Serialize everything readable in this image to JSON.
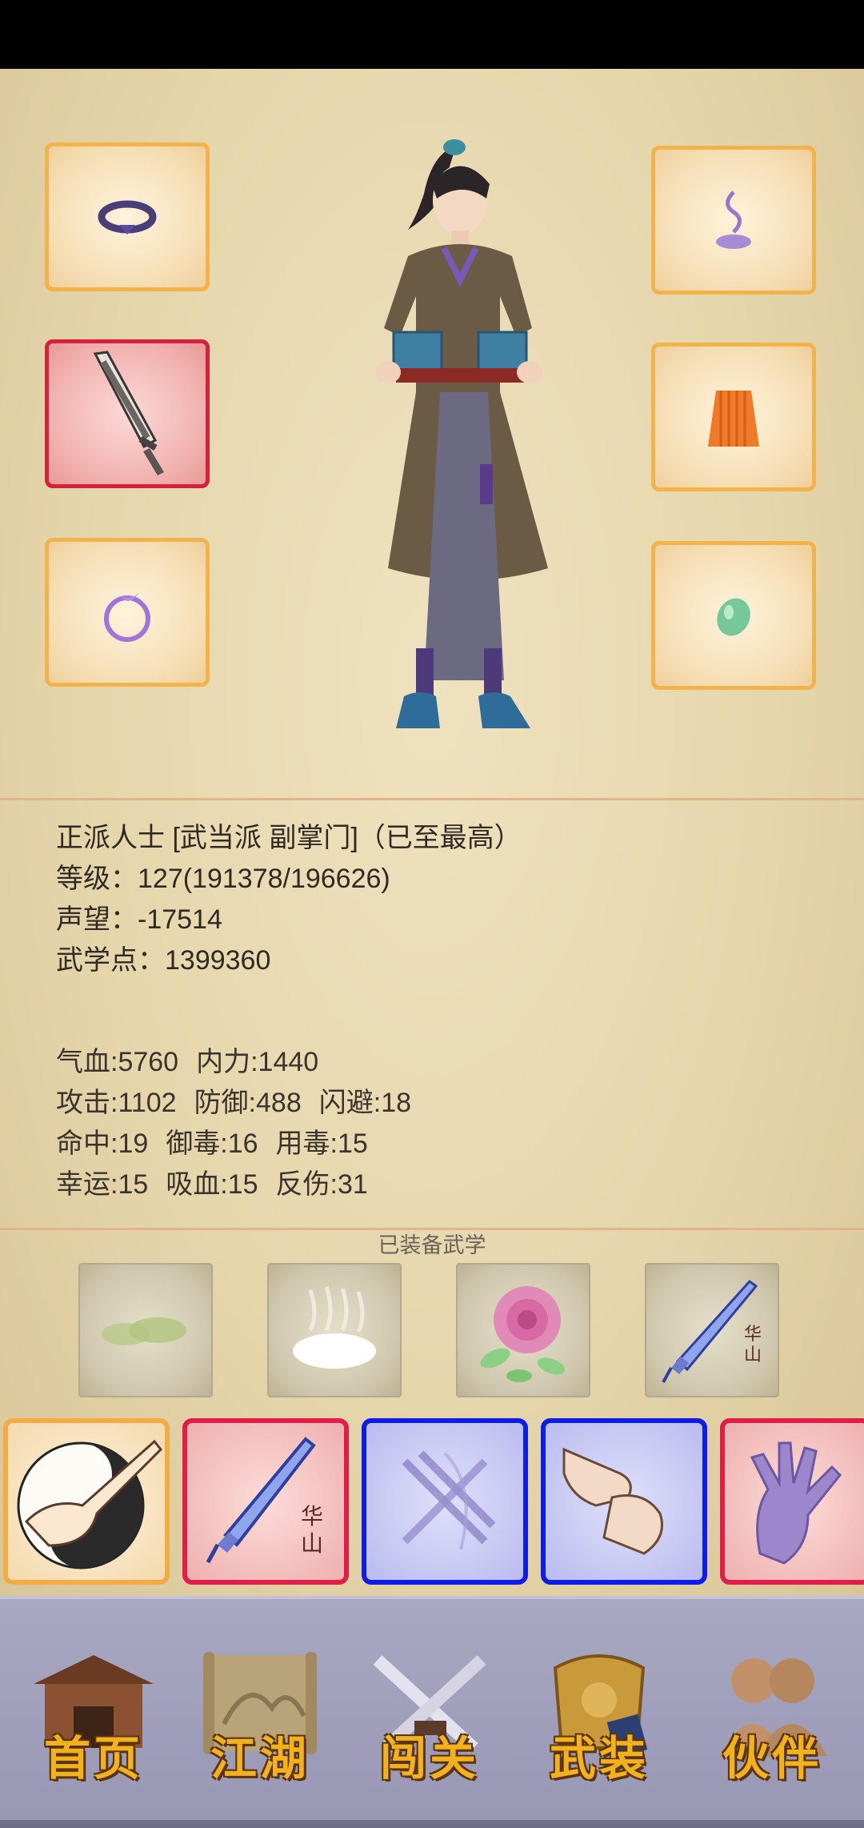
{
  "profile": {
    "title_line": "正派人士 [武当派 副掌门]（已至最高）",
    "level_line": "等级：127(191378/196626)",
    "reputation_line": "声望：-17514",
    "martial_points_line": "武学点：1399360"
  },
  "stats": [
    [
      "气血:5760",
      "内力:1440"
    ],
    [
      "攻击:1102",
      "防御:488",
      "闪避:18"
    ],
    [
      "命中:19",
      "御毒:16",
      "用毒:15"
    ],
    [
      "幸运:15",
      "吸血:15",
      "反伤:31"
    ]
  ],
  "equipment": {
    "left": [
      "headband-icon",
      "saber-icon",
      "ring-icon"
    ],
    "right": [
      "incense-icon",
      "cloak-icon",
      "jade-icon"
    ]
  },
  "equipped_skills": {
    "title": "已装备武学",
    "tiles": [
      "green-cloud-icon",
      "white-mist-icon",
      "rose-icon",
      "hua-shan-sword-icon"
    ],
    "sword_mark": "华\n山"
  },
  "skill_cards": {
    "items": [
      {
        "icon": "taiji-palm-icon",
        "border": "orange"
      },
      {
        "icon": "hua-shan-sword-icon",
        "border": "crimson",
        "mark": "华\n山"
      },
      {
        "icon": "crossed-blades-icon",
        "border": "blue"
      },
      {
        "icon": "fist-icon",
        "border": "blue"
      },
      {
        "icon": "claw-hand-icon",
        "border": "crimson"
      }
    ]
  },
  "nav": {
    "items": [
      {
        "label": "首页",
        "icon": "house-icon"
      },
      {
        "label": "江湖",
        "icon": "scroll-map-icon"
      },
      {
        "label": "闯关",
        "icon": "crossed-swords-icon"
      },
      {
        "label": "武装",
        "icon": "armor-icon"
      },
      {
        "label": "伙伴",
        "icon": "partners-icon"
      }
    ]
  },
  "colors": {
    "parchment": "#e6d6ac",
    "slot_border": "#f2b24c",
    "slot_selected_border": "#d4223d",
    "card_blue": "#0d1ce6",
    "card_crimson": "#e01e48",
    "nav_gold": "#f2b21e"
  }
}
